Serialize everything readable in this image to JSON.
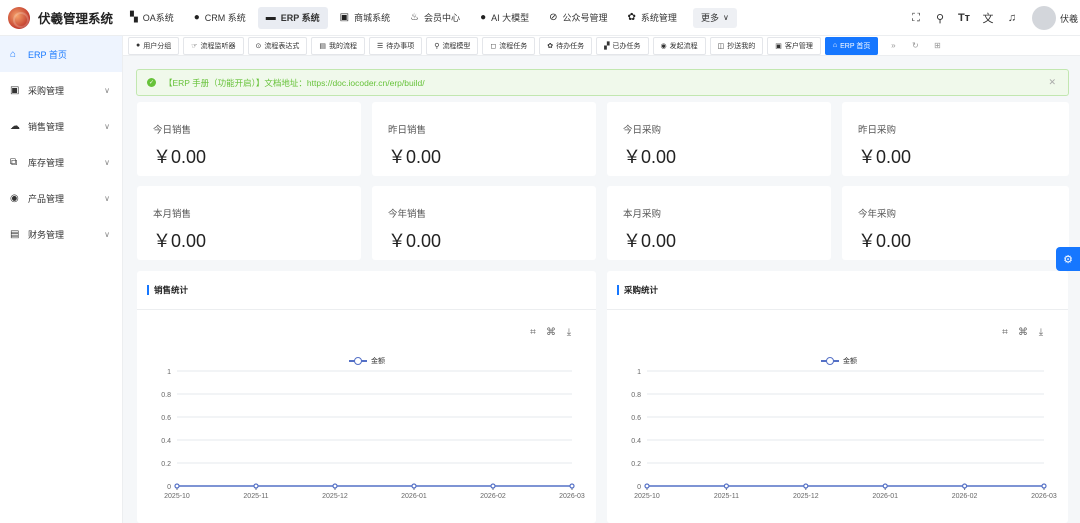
{
  "app": {
    "title": "伏羲管理系统"
  },
  "topnav": [
    {
      "label": "OA系统",
      "icon": "oa-icon",
      "glyph": "▚",
      "active": false
    },
    {
      "label": "CRM 系统",
      "icon": "user-icon",
      "glyph": "●",
      "active": false
    },
    {
      "label": "ERP 系统",
      "icon": "erp-icon",
      "glyph": "▬",
      "active": true
    },
    {
      "label": "商城系统",
      "icon": "shop-icon",
      "glyph": "▣",
      "active": false
    },
    {
      "label": "会员中心",
      "icon": "member-icon",
      "glyph": "♨",
      "active": false
    },
    {
      "label": "AI 大模型",
      "icon": "ai-icon",
      "glyph": "●",
      "active": false
    },
    {
      "label": "公众号管理",
      "icon": "wechat-icon",
      "glyph": "⊘",
      "active": false
    },
    {
      "label": "系统管理",
      "icon": "gear-icon",
      "glyph": "✿",
      "active": false
    }
  ],
  "more": {
    "label": "更多",
    "chevron": "∨"
  },
  "user": {
    "name": "伏羲"
  },
  "sidebar": [
    {
      "label": "ERP 首页",
      "icon": "home-icon",
      "glyph": "⌂",
      "active": true,
      "expandable": false
    },
    {
      "label": "采购管理",
      "icon": "purchase-icon",
      "glyph": "▣",
      "active": false,
      "expandable": true
    },
    {
      "label": "销售管理",
      "icon": "sales-icon",
      "glyph": "☁",
      "active": false,
      "expandable": true
    },
    {
      "label": "库存管理",
      "icon": "inventory-icon",
      "glyph": "⧉",
      "active": false,
      "expandable": true
    },
    {
      "label": "产品管理",
      "icon": "product-icon",
      "glyph": "◉",
      "active": false,
      "expandable": true
    },
    {
      "label": "财务管理",
      "icon": "finance-icon",
      "glyph": "▤",
      "active": false,
      "expandable": true
    }
  ],
  "tabs": [
    {
      "label": "用户分组",
      "glyph": "●"
    },
    {
      "label": "流程监听器",
      "glyph": "☞"
    },
    {
      "label": "流程表达式",
      "glyph": "⊙"
    },
    {
      "label": "我的流程",
      "glyph": "▤"
    },
    {
      "label": "待办事项",
      "glyph": "☰"
    },
    {
      "label": "流程模型",
      "glyph": "⚲"
    },
    {
      "label": "流程任务",
      "glyph": "◻"
    },
    {
      "label": "待办任务",
      "glyph": "✿"
    },
    {
      "label": "已办任务",
      "glyph": "▞"
    },
    {
      "label": "发起流程",
      "glyph": "◉"
    },
    {
      "label": "抄送我的",
      "glyph": "◫"
    },
    {
      "label": "客户管理",
      "glyph": "▣"
    },
    {
      "label": "ERP 首页",
      "glyph": "⌂",
      "active": true
    }
  ],
  "alert": {
    "text": "【ERP 手册（功能开启）】文档地址：https://doc.iocoder.cn/erp/build/"
  },
  "stats": [
    {
      "label": "今日销售",
      "value": "￥0.00"
    },
    {
      "label": "昨日销售",
      "value": "￥0.00"
    },
    {
      "label": "今日采购",
      "value": "￥0.00"
    },
    {
      "label": "昨日采购",
      "value": "￥0.00"
    },
    {
      "label": "本月销售",
      "value": "￥0.00"
    },
    {
      "label": "今年销售",
      "value": "￥0.00"
    },
    {
      "label": "本月采购",
      "value": "￥0.00"
    },
    {
      "label": "今年采购",
      "value": "￥0.00"
    }
  ],
  "panels": [
    {
      "title": "销售统计"
    },
    {
      "title": "采购统计"
    }
  ],
  "chart_data": [
    {
      "type": "line",
      "title": "销售统计",
      "categories": [
        "2025-10",
        "2025-11",
        "2025-12",
        "2026-01",
        "2026-02",
        "2026-03"
      ],
      "series": [
        {
          "name": "金额",
          "values": [
            0,
            0,
            0,
            0,
            0,
            0
          ]
        }
      ],
      "ylim": [
        0,
        1
      ],
      "yticks": [
        "0",
        "0.2",
        "0.4",
        "0.6",
        "0.8",
        "1"
      ],
      "legend": "top-center",
      "color": "#5470c6",
      "grid": true
    },
    {
      "type": "line",
      "title": "采购统计",
      "categories": [
        "2025-10",
        "2025-11",
        "2025-12",
        "2026-01",
        "2026-02",
        "2026-03"
      ],
      "series": [
        {
          "name": "金额",
          "values": [
            0,
            0,
            0,
            0,
            0,
            0
          ]
        }
      ],
      "ylim": [
        0,
        1
      ],
      "yticks": [
        "0",
        "0.2",
        "0.4",
        "0.6",
        "0.8",
        "1"
      ],
      "legend": "top-center",
      "color": "#5470c6",
      "grid": true
    }
  ]
}
